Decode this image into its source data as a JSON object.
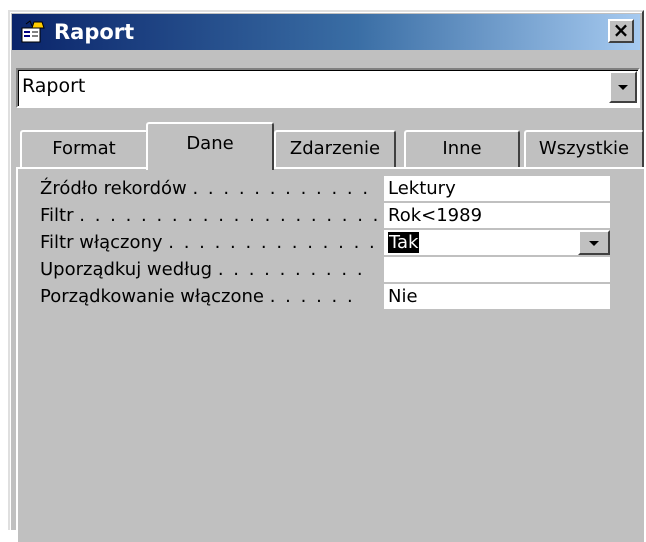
{
  "window": {
    "title": "Raport",
    "close_label": "×"
  },
  "object_selector": {
    "value": "Raport"
  },
  "tabs": [
    {
      "label": "Format",
      "active": false
    },
    {
      "label": "Dane",
      "active": true
    },
    {
      "label": "Zdarzenie",
      "active": false
    },
    {
      "label": "Inne",
      "active": false
    },
    {
      "label": "Wszystkie",
      "active": false
    }
  ],
  "properties": [
    {
      "label": "Źródło rekordów",
      "dots": ". . . . . . . . . . . .",
      "value": "Lektury"
    },
    {
      "label": "Filtr",
      "dots": ". . . . . . . . . . . . . . . . . . . . .",
      "value": "Rok<1989"
    },
    {
      "label": "Filtr włączony",
      "dots": ". . . . . . . . . . . . . .",
      "value": "Tak",
      "selected": true,
      "has_dropdown": true
    },
    {
      "label": "Uporządkuj według",
      "dots": ". . . . . . . . . .",
      "value": ""
    },
    {
      "label": "Porządkowanie włączone",
      "dots": ". . . . . .",
      "value": "Nie"
    }
  ],
  "colors": {
    "title_start": "#0a246a",
    "title_end": "#a6caf0",
    "face": "#c0c0c0"
  }
}
